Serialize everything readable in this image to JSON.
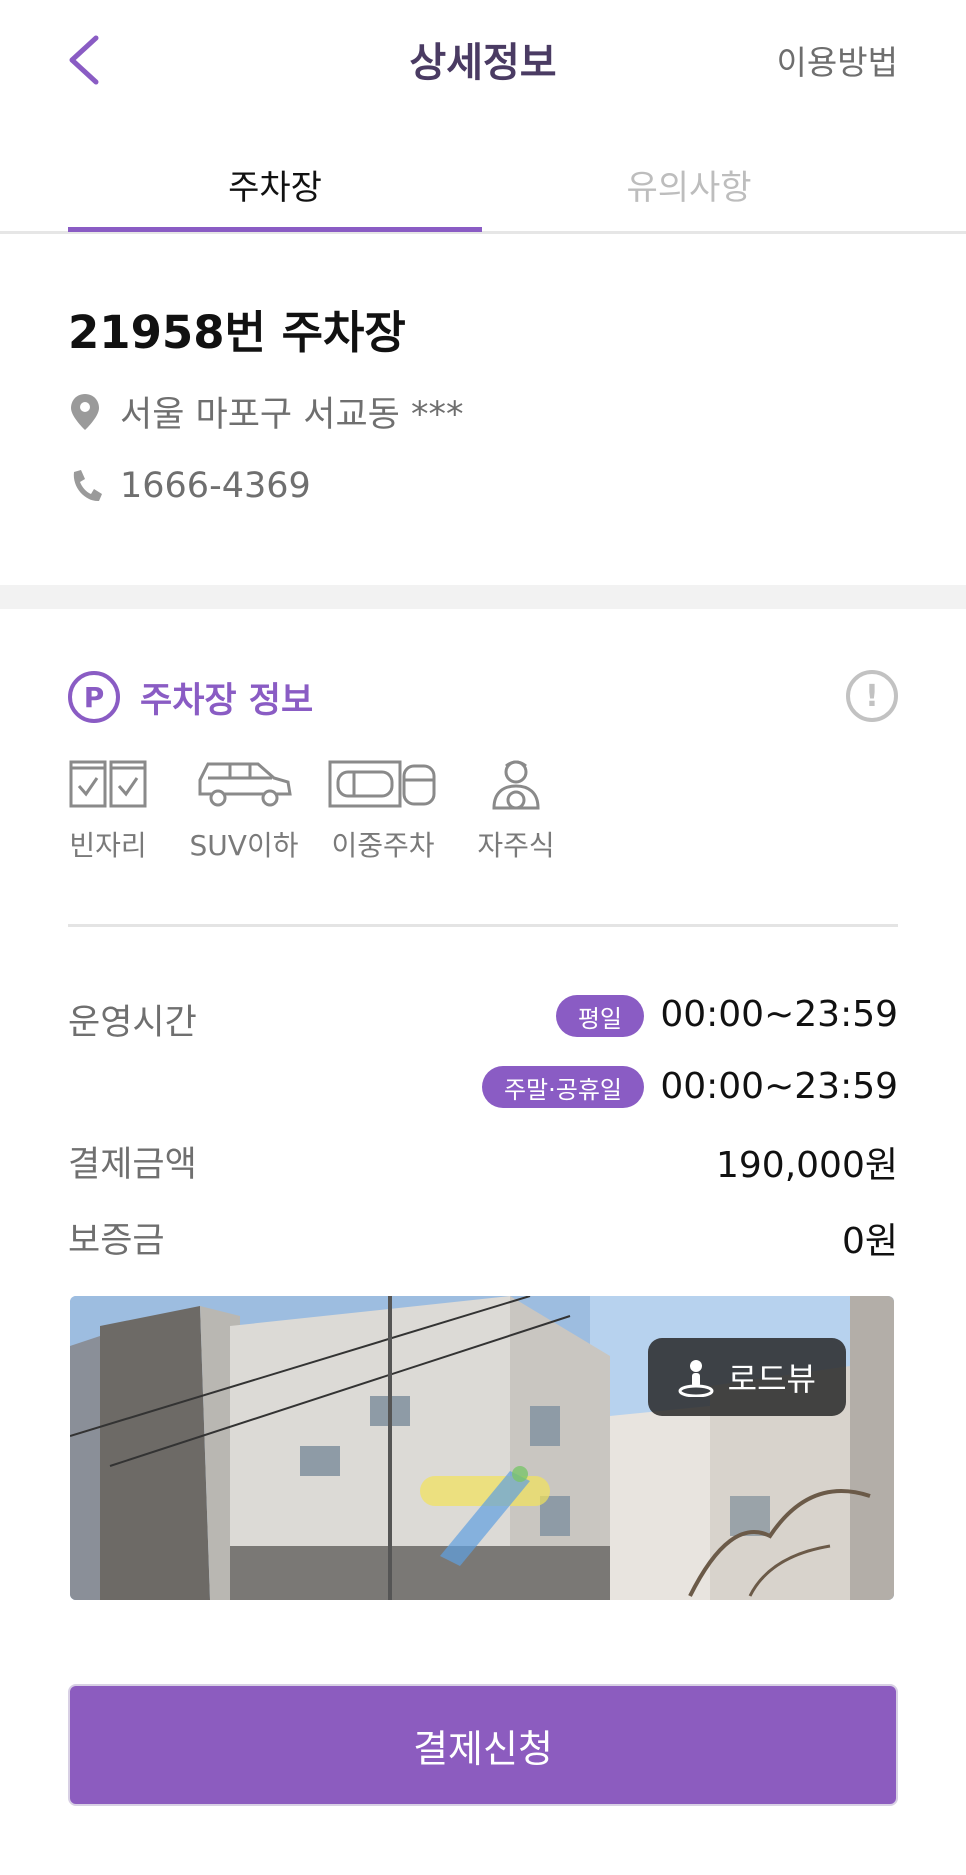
{
  "header": {
    "title": "상세정보",
    "help_link": "이용방법"
  },
  "tabs": [
    {
      "label": "주차장",
      "active": true
    },
    {
      "label": "유의사항",
      "active": false
    }
  ],
  "lot": {
    "name": "21958번 주차장",
    "address": "서울 마포구 서교동 ***",
    "phone": "1666-4369"
  },
  "parking_info": {
    "badge": "P",
    "title": "주차장 정보",
    "info_icon": "!",
    "features": [
      {
        "icon": "parking-spaces-icon",
        "label": "빈자리"
      },
      {
        "icon": "suv-icon",
        "label": "SUV이하"
      },
      {
        "icon": "double-parking-icon",
        "label": "이중주차"
      },
      {
        "icon": "self-parking-icon",
        "label": "자주식"
      }
    ]
  },
  "details": {
    "hours_label": "운영시간",
    "weekday_tag": "평일",
    "weekday_hours": "00:00~23:59",
    "weekend_tag": "주말·공휴일",
    "weekend_hours": "00:00~23:59",
    "payment_label": "결제금액",
    "payment_value": "190,000원",
    "deposit_label": "보증금",
    "deposit_value": "0원"
  },
  "photo": {
    "roadview_label": "로드뷰"
  },
  "pay_button": "결제신청",
  "colors": {
    "accent": "#8a5cc4",
    "title": "#4a3b63",
    "muted": "#6f6f6f"
  }
}
